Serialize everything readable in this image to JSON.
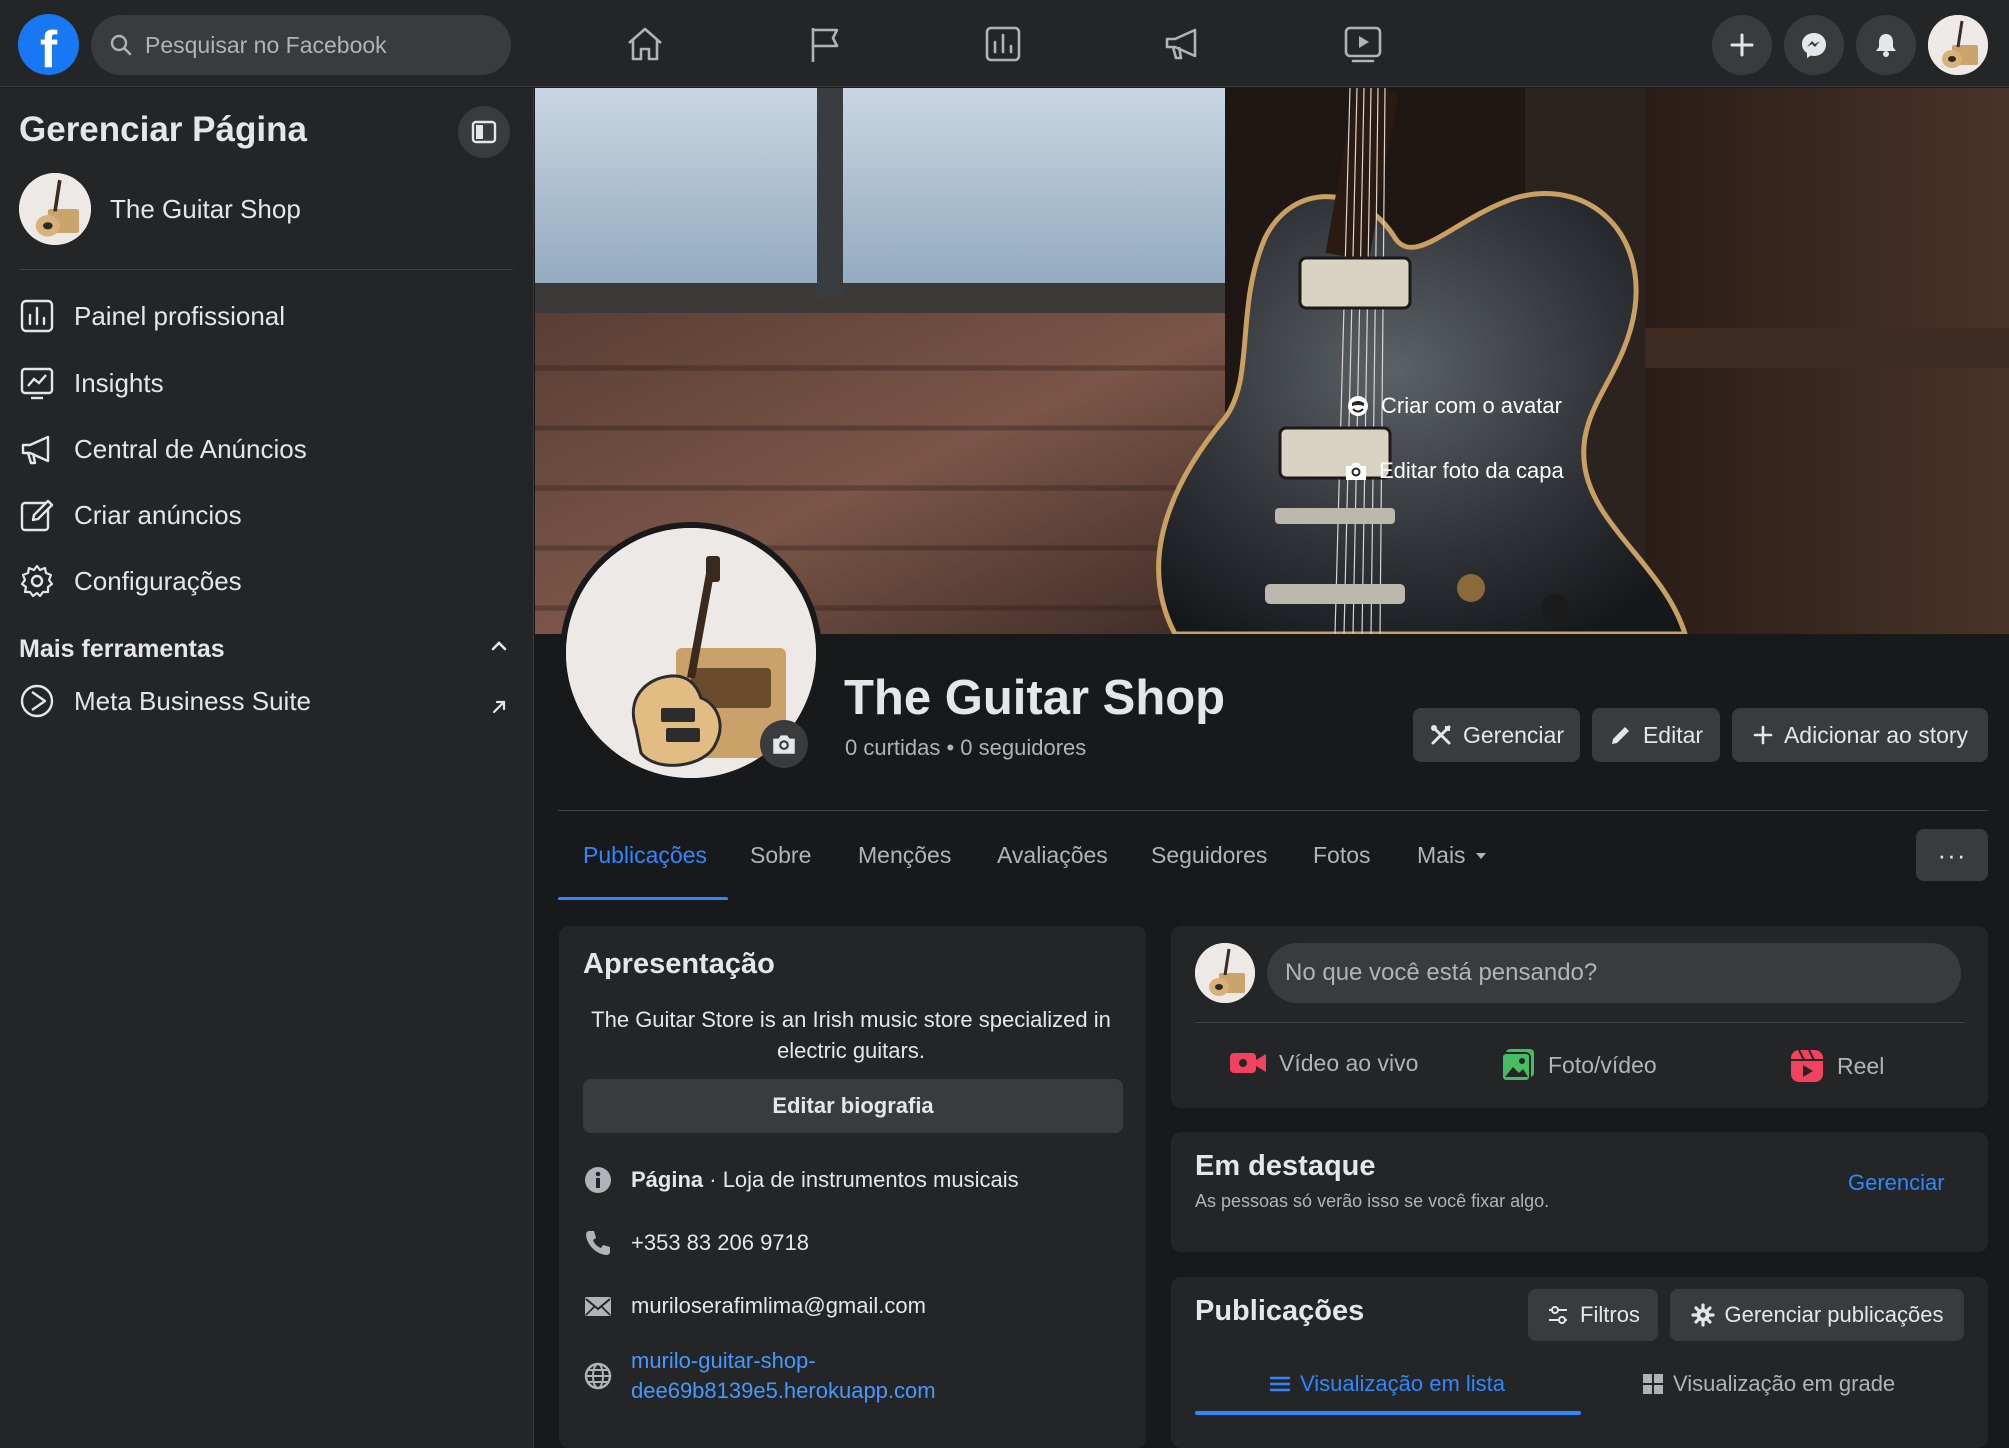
{
  "topbar": {
    "search_placeholder": "Pesquisar no Facebook"
  },
  "sidebar": {
    "title": "Gerenciar Página",
    "page_name": "The Guitar Shop",
    "items": [
      {
        "label": "Painel profissional",
        "icon": "dashboard-icon"
      },
      {
        "label": "Insights",
        "icon": "insights-icon"
      },
      {
        "label": "Central de Anúncios",
        "icon": "megaphone-icon"
      },
      {
        "label": "Criar anúncios",
        "icon": "edit-icon"
      },
      {
        "label": "Configurações",
        "icon": "gear-icon"
      }
    ],
    "section_title": "Mais ferramentas",
    "tool": {
      "label": "Meta Business Suite",
      "icon": "meta-business-icon"
    }
  },
  "cover": {
    "avatar_btn": "Criar com o avatar",
    "edit_cover_btn": "Editar foto da capa"
  },
  "profile": {
    "name": "The Guitar Shop",
    "stats": "0 curtidas • 0 seguidores",
    "actions": {
      "manage": "Gerenciar",
      "edit": "Editar",
      "story": "Adicionar ao story"
    }
  },
  "tabs": [
    "Publicações",
    "Sobre",
    "Menções",
    "Avaliações",
    "Seguidores",
    "Fotos",
    "Mais"
  ],
  "more_btn": "···",
  "intro": {
    "title": "Apresentação",
    "bio": "The Guitar Store is an Irish music store specialized in electric guitars.",
    "edit_bio": "Editar biografia",
    "page_type_bold": "Página",
    "page_type_rest": " · Loja de instrumentos musicais",
    "phone": "+353 83 206 9718",
    "email": "muriloserafimlima@gmail.com",
    "website": "murilo-guitar-shop-dee69b8139e5.herokuapp.com",
    "website_line1": "murilo-guitar-shop-",
    "website_line2": "dee69b8139e5.herokuapp.com"
  },
  "composer": {
    "placeholder": "No que você está pensando?",
    "live": "Vídeo ao vivo",
    "photo": "Foto/vídeo",
    "reel": "Reel"
  },
  "featured": {
    "title": "Em destaque",
    "subtitle": "As pessoas só verão isso se você fixar algo.",
    "manage": "Gerenciar"
  },
  "posts": {
    "title": "Publicações",
    "filters": "Filtros",
    "manage_posts": "Gerenciar publicações",
    "list_view": "Visualização em lista",
    "grid_view": "Visualização em grade"
  },
  "colors": {
    "accent": "#2d88ff",
    "surface": "#242526",
    "background": "#18191a",
    "button": "#3a3b3c"
  }
}
